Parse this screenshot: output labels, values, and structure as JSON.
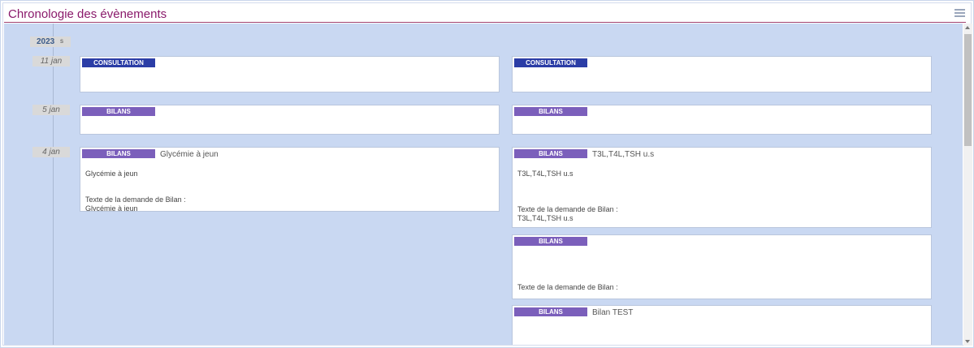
{
  "header": {
    "title": "Chronologie des évènements",
    "menu_icon": "hamburger-menu-icon"
  },
  "timeline": {
    "year": "2023",
    "year_suffix": "s",
    "dates": [
      "11 jan",
      "5 jan",
      "4 jan"
    ]
  },
  "cards": {
    "c1": {
      "tag": "CONSULTATION"
    },
    "c2": {
      "tag": "CONSULTATION"
    },
    "c3": {
      "tag": "BILANS"
    },
    "c4": {
      "tag": "BILANS"
    },
    "c5": {
      "tag": "BILANS",
      "title": "Glycémie à jeun",
      "line1": "Glycémie à jeun",
      "line2": "Texte de la demande de Bilan :",
      "line3": "Glycémie à jeun"
    },
    "c6": {
      "tag": "BILANS",
      "title": "T3L,T4L,TSH u.s",
      "line1": "T3L,T4L,TSH u.s",
      "line2": "Texte de la demande de Bilan :",
      "line3": "T3L,T4L,TSH u.s"
    },
    "c7": {
      "tag": "BILANS",
      "line2": "Texte de la demande de Bilan :"
    },
    "c8": {
      "tag": "BILANS",
      "title": "Bilan TEST"
    }
  },
  "colors": {
    "consultation": "#2b3da6",
    "bilans": "#7b5fbb",
    "title": "#8a1a6b",
    "background": "#c9d8f2"
  }
}
